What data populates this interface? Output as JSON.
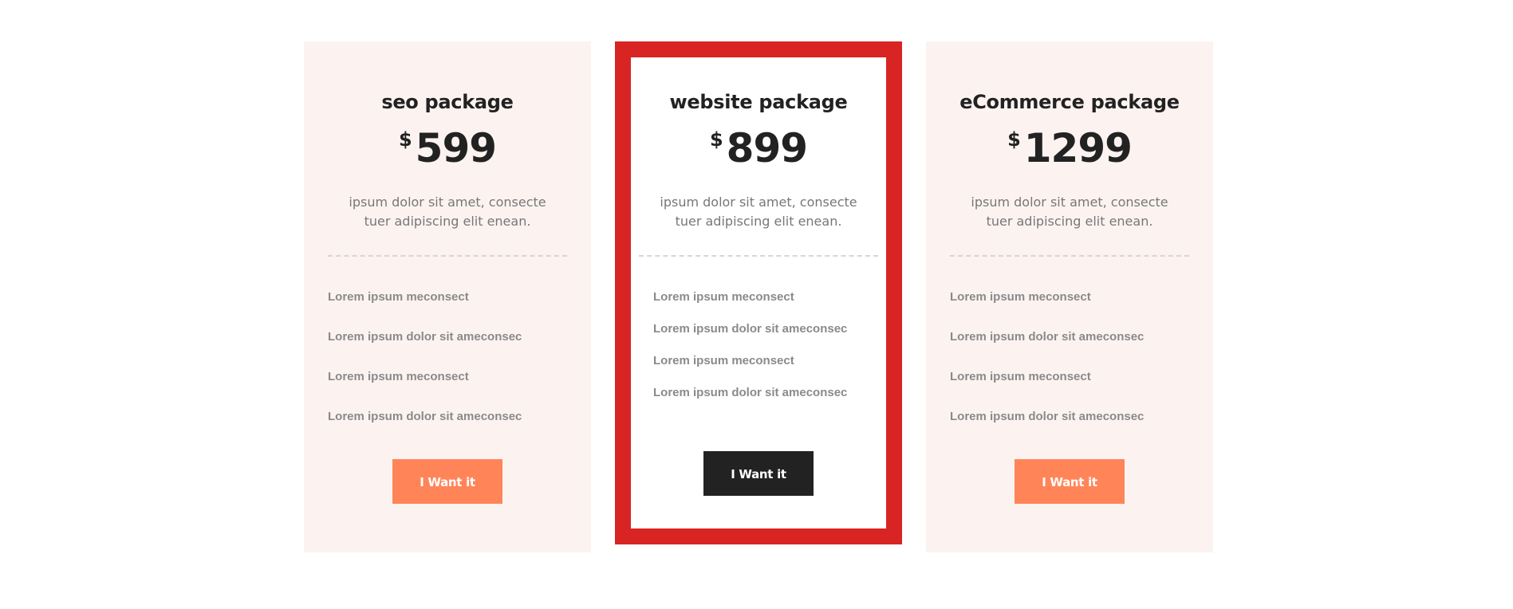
{
  "colors": {
    "card_bg": "#fcf3f1",
    "featured_border": "#d92424",
    "button_primary": "#ff8559",
    "button_dark": "#222222",
    "title_text": "#222222",
    "body_text": "#777777",
    "feature_text": "#8a8a8a"
  },
  "packages": [
    {
      "title": "seo package",
      "currency": "$",
      "price": "599",
      "description": "ipsum dolor sit amet, consecte tuer adipiscing elit enean.",
      "features": [
        "Lorem ipsum meconsect",
        "Lorem ipsum dolor sit ameconsec",
        "Lorem ipsum meconsect",
        "Lorem ipsum dolor sit ameconsec"
      ],
      "button_label": "I Want it"
    },
    {
      "title": "website package",
      "currency": "$",
      "price": "899",
      "description": "ipsum dolor sit amet, consecte tuer adipiscing elit enean.",
      "features": [
        "Lorem ipsum meconsect",
        "Lorem ipsum dolor sit ameconsec",
        "Lorem ipsum meconsect",
        "Lorem ipsum dolor sit ameconsec"
      ],
      "button_label": "I Want it"
    },
    {
      "title": "eCommerce package",
      "currency": "$",
      "price": "1299",
      "description": "ipsum dolor sit amet, consecte tuer adipiscing elit enean.",
      "features": [
        "Lorem ipsum meconsect",
        "Lorem ipsum dolor sit ameconsec",
        "Lorem ipsum meconsect",
        "Lorem ipsum dolor sit ameconsec"
      ],
      "button_label": "I Want it"
    }
  ]
}
